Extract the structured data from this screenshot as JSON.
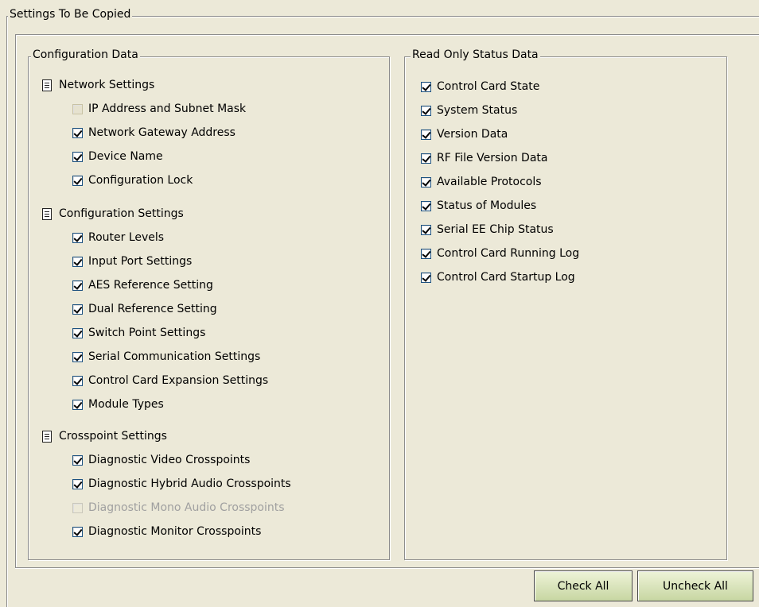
{
  "panel": {
    "title": "Settings To Be Copied"
  },
  "configuration": {
    "title": "Configuration Data",
    "sections": [
      {
        "title": "Network Settings",
        "items": [
          {
            "label": "IP Address and Subnet Mask",
            "checked": false,
            "enabled": true
          },
          {
            "label": "Network Gateway Address",
            "checked": true,
            "enabled": true
          },
          {
            "label": "Device Name",
            "checked": true,
            "enabled": true
          },
          {
            "label": "Configuration Lock",
            "checked": true,
            "enabled": true
          }
        ]
      },
      {
        "title": "Configuration Settings",
        "items": [
          {
            "label": "Router Levels",
            "checked": true,
            "enabled": true
          },
          {
            "label": "Input Port Settings",
            "checked": true,
            "enabled": true
          },
          {
            "label": "AES Reference Setting",
            "checked": true,
            "enabled": true
          },
          {
            "label": "Dual Reference Setting",
            "checked": true,
            "enabled": true
          },
          {
            "label": "Switch Point Settings",
            "checked": true,
            "enabled": true
          },
          {
            "label": "Serial Communication Settings",
            "checked": true,
            "enabled": true
          },
          {
            "label": "Control Card Expansion Settings",
            "checked": true,
            "enabled": true
          },
          {
            "label": "Module Types",
            "checked": true,
            "enabled": true
          }
        ]
      },
      {
        "title": "Crosspoint Settings",
        "items": [
          {
            "label": "Diagnostic Video Crosspoints",
            "checked": true,
            "enabled": true
          },
          {
            "label": "Diagnostic Hybrid Audio Crosspoints",
            "checked": true,
            "enabled": true
          },
          {
            "label": "Diagnostic Mono Audio Crosspoints",
            "checked": false,
            "enabled": false
          },
          {
            "label": "Diagnostic Monitor Crosspoints",
            "checked": true,
            "enabled": true
          }
        ]
      }
    ]
  },
  "status": {
    "title": "Read Only Status Data",
    "items": [
      {
        "label": "Control Card State",
        "checked": true
      },
      {
        "label": "System Status",
        "checked": true
      },
      {
        "label": "Version Data",
        "checked": true
      },
      {
        "label": "RF File Version Data",
        "checked": true
      },
      {
        "label": "Available Protocols",
        "checked": true
      },
      {
        "label": "Status of Modules",
        "checked": true
      },
      {
        "label": "Serial EE Chip Status",
        "checked": true
      },
      {
        "label": "Control Card Running Log",
        "checked": true
      },
      {
        "label": "Control Card Startup Log",
        "checked": true
      }
    ]
  },
  "buttons": {
    "check_all": "Check All",
    "uncheck_all": "Uncheck All"
  },
  "icons": {
    "section": "document-icon"
  }
}
